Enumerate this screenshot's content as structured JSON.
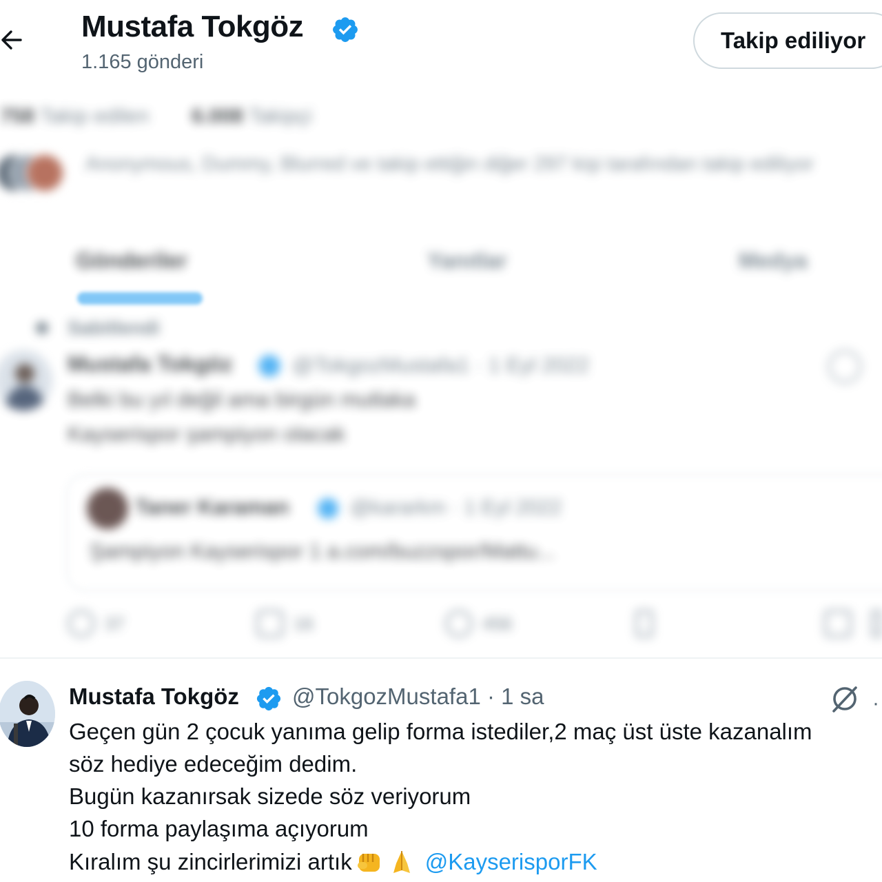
{
  "header": {
    "name": "Mustafa Tokgöz",
    "post_count": "1.165 gönderi",
    "follow_button": "Takip ediliyor"
  },
  "stats": {
    "following_num": "758",
    "following_label": "Takip edilen",
    "followers_num": "6.008",
    "followers_label": "Takipçi"
  },
  "mutual_text": "Anonymous, Dummy, Blurred ve takip ettiğin diğer 297 kişi tarafından takip ediliyor",
  "tabs": [
    "Gönderiler",
    "Yanıtlar",
    "Medya"
  ],
  "pinned": {
    "label": "Sabitlendi",
    "name": "Mustafa Tokgöz",
    "handle": "@TokgozMustafa1 · 1 Eyl 2022",
    "text_1": "Belki bu yıl değil ama birgün mutlaka",
    "text_2": "Kayserispor şampiyon olacak",
    "quote": {
      "name": "Taner Karaman",
      "handle": "@kararkm · 1 Eyl 2022",
      "text": "Şampiyon Kayserispor 1 a.com/buzzspor/Mattu..."
    },
    "actions": {
      "reply": "37",
      "retweet": "16",
      "like": "456",
      "views": ""
    }
  },
  "tweet": {
    "name": "Mustafa Tokgöz",
    "handle": "@TokgozMustafa1 · 1 sa",
    "more": "·",
    "line_1": "Geçen gün 2 çocuk yanıma gelip forma istediler,2 maç üst üste kazanalım",
    "line_2": "söz hediye edeceğim dedim.",
    "line_3": "Bugün kazanırsak sizede söz veriyorum",
    "line_4": "10 forma paylaşıma açıyorum",
    "line_5": "Kıralım şu zincirlerimizi artık",
    "mention": "@KayserisporFK",
    "emojis": [
      "fist-emoji",
      "folded-hands-emoji"
    ]
  },
  "colors": {
    "accent": "#1d9bf0",
    "text": "#0f1419",
    "secondary": "#536471",
    "border": "#cfd9de"
  },
  "icons": [
    "back-arrow-icon",
    "verified-badge-icon",
    "pin-icon",
    "grok-icon",
    "reply-icon",
    "retweet-icon",
    "like-icon",
    "views-icon",
    "bookmark-icon",
    "share-icon"
  ]
}
